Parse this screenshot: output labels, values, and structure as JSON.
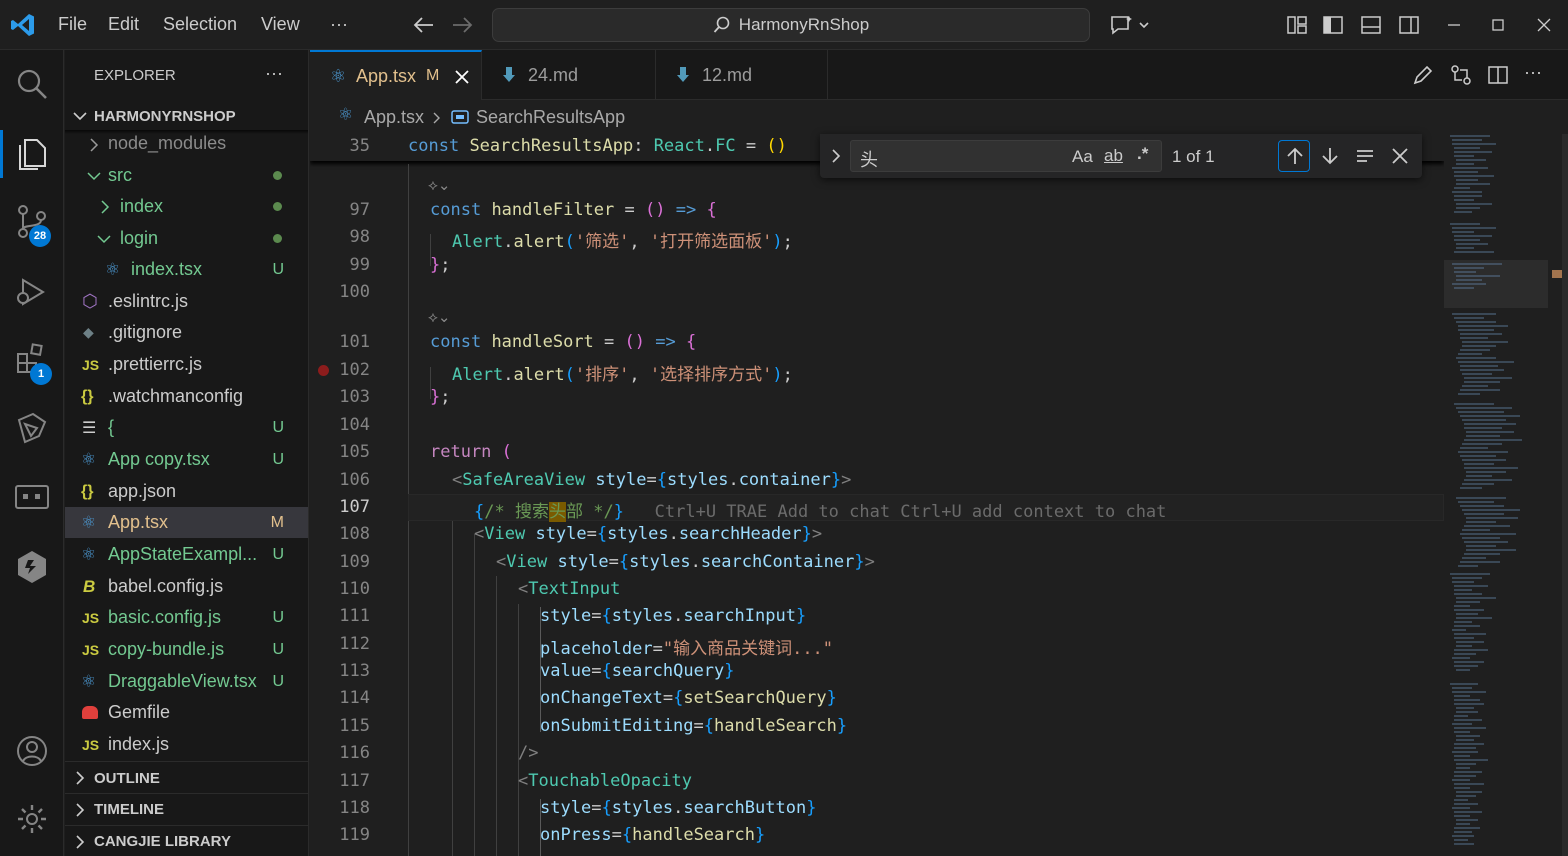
{
  "titlebar": {
    "menu": [
      "File",
      "Edit",
      "Selection",
      "View",
      "···"
    ],
    "search": "HarmonyRnShop"
  },
  "activity": {
    "scm_badge": "28",
    "ext_badge": "1"
  },
  "explorer": {
    "title": "EXPLORER",
    "more": "···",
    "project": "HARMONYRNSHOP",
    "items": [
      {
        "label": "node_modules",
        "status": ""
      },
      {
        "label": "src",
        "status": ""
      },
      {
        "label": "index",
        "status": ""
      },
      {
        "label": "login",
        "status": ""
      },
      {
        "label": "index.tsx",
        "status": "U"
      },
      {
        "label": ".eslintrc.js",
        "status": ""
      },
      {
        "label": ".gitignore",
        "status": ""
      },
      {
        "label": ".prettierrc.js",
        "status": ""
      },
      {
        "label": ".watchmanconfig",
        "status": ""
      },
      {
        "label": "{",
        "status": "U"
      },
      {
        "label": "App copy.tsx",
        "status": "U"
      },
      {
        "label": "app.json",
        "status": ""
      },
      {
        "label": "App.tsx",
        "status": "M"
      },
      {
        "label": "AppStateExampl...",
        "status": "U"
      },
      {
        "label": "babel.config.js",
        "status": ""
      },
      {
        "label": "basic.config.js",
        "status": "U"
      },
      {
        "label": "copy-bundle.js",
        "status": "U"
      },
      {
        "label": "DraggableView.tsx",
        "status": "U"
      },
      {
        "label": "Gemfile",
        "status": ""
      },
      {
        "label": "index.js",
        "status": ""
      }
    ],
    "sections": [
      "OUTLINE",
      "TIMELINE",
      "CANGJIE LIBRARY"
    ]
  },
  "tabs": [
    {
      "label": "App.tsx",
      "status": "M"
    },
    {
      "label": "24.md",
      "status": ""
    },
    {
      "label": "12.md",
      "status": ""
    }
  ],
  "breadcrumb": {
    "file": "App.tsx",
    "symbol": "SearchResultsApp"
  },
  "find": {
    "query": "头",
    "opt_case": "Aa",
    "opt_word": "ab",
    "opt_regex": ".*",
    "result": "1 of 1"
  },
  "editor": {
    "lines": [
      {
        "n": "35",
        "t": "const SearchResultsApp: React.FC = ()"
      },
      {
        "n": "97",
        "t": "const handleFilter = () => {"
      },
      {
        "n": "98",
        "t": "Alert.alert('筛选', '打开筛选面板');"
      },
      {
        "n": "99",
        "t": "};"
      },
      {
        "n": "100",
        "t": ""
      },
      {
        "n": "101",
        "t": "const handleSort = () => {"
      },
      {
        "n": "102",
        "t": "Alert.alert('排序', '选择排序方式');"
      },
      {
        "n": "103",
        "t": "};"
      },
      {
        "n": "104",
        "t": ""
      },
      {
        "n": "105",
        "t": "return ("
      },
      {
        "n": "106",
        "t": "<SafeAreaView style={styles.container}>"
      },
      {
        "n": "107",
        "t": "{/* 搜索头部 */}"
      },
      {
        "n": "108",
        "t": "<View style={styles.searchHeader}>"
      },
      {
        "n": "109",
        "t": "<View style={styles.searchContainer}>"
      },
      {
        "n": "110",
        "t": "<TextInput"
      },
      {
        "n": "111",
        "t": "style={styles.searchInput}"
      },
      {
        "n": "112",
        "t": "placeholder=\"输入商品关键词...\""
      },
      {
        "n": "113",
        "t": "value={searchQuery}"
      },
      {
        "n": "114",
        "t": "onChangeText={setSearchQuery}"
      },
      {
        "n": "115",
        "t": "onSubmitEditing={handleSearch}"
      },
      {
        "n": "116",
        "t": "/>"
      },
      {
        "n": "117",
        "t": "<TouchableOpacity"
      },
      {
        "n": "118",
        "t": "style={styles.searchButton}"
      },
      {
        "n": "119",
        "t": "onPress={handleSearch}"
      }
    ],
    "ghost_hint": "Ctrl+U TRAE Add to chat Ctrl+U add context to chat"
  }
}
